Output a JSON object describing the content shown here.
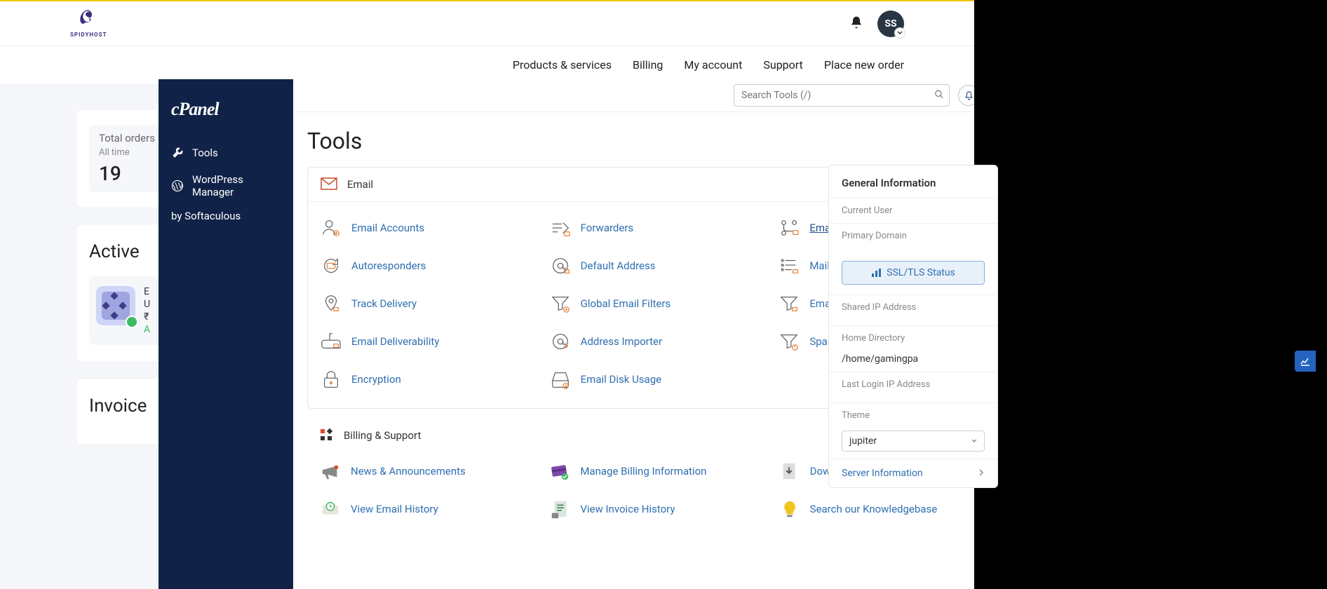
{
  "brand": {
    "name": "SPIDYHOST"
  },
  "header": {
    "avatar_initials": "SS"
  },
  "nav": {
    "products": "Products & services",
    "billing": "Billing",
    "myaccount": "My account",
    "support": "Support",
    "place_order": "Place new order"
  },
  "dashboard": {
    "total_orders_label": "Total orders",
    "all_time": "All time",
    "orders_count": "19",
    "active_title": "Active",
    "product": {
      "l1": "E",
      "l2": "U",
      "l3": "₹",
      "l4": "A"
    },
    "invoices_title": "Invoice"
  },
  "cpanel": {
    "brand": "cPanel",
    "sidebar": {
      "tools": "Tools",
      "wp": "WordPress Manager",
      "wp2": "by Softaculous"
    },
    "search_placeholder": "Search Tools (/)",
    "page_title": "Tools",
    "email": {
      "title": "Email",
      "items": {
        "accounts": "Email Accounts",
        "forwarders": "Forwarders",
        "routing": "Email Routing",
        "autoresponders": "Autoresponders",
        "default_address": "Default Address",
        "mailing_lists": "Mailing Lists",
        "track_delivery": "Track Delivery",
        "global_filters": "Global Email Filters",
        "email_filters": "Email Filters",
        "deliverability": "Email Deliverability",
        "address_importer": "Address Importer",
        "spam_filters": "Spam Filters",
        "encryption": "Encryption",
        "disk_usage": "Email Disk Usage"
      }
    },
    "billing": {
      "title": "Billing & Support",
      "items": {
        "news": "News & Announcements",
        "manage_billing": "Manage Billing Information",
        "download": "Download Resources",
        "email_history": "View Email History",
        "invoice_history": "View Invoice History",
        "kb": "Search our Knowledgebase"
      }
    }
  },
  "info": {
    "title": "General Information",
    "current_user": "Current User",
    "primary_domain": "Primary Domain",
    "ssl_button": "SSL/TLS Status",
    "shared_ip": "Shared IP Address",
    "home_dir_label": "Home Directory",
    "home_dir": "/home/gamingpa",
    "last_login": "Last Login IP Address",
    "theme_label": "Theme",
    "theme_value": "jupiter",
    "server_info": "Server Information"
  }
}
